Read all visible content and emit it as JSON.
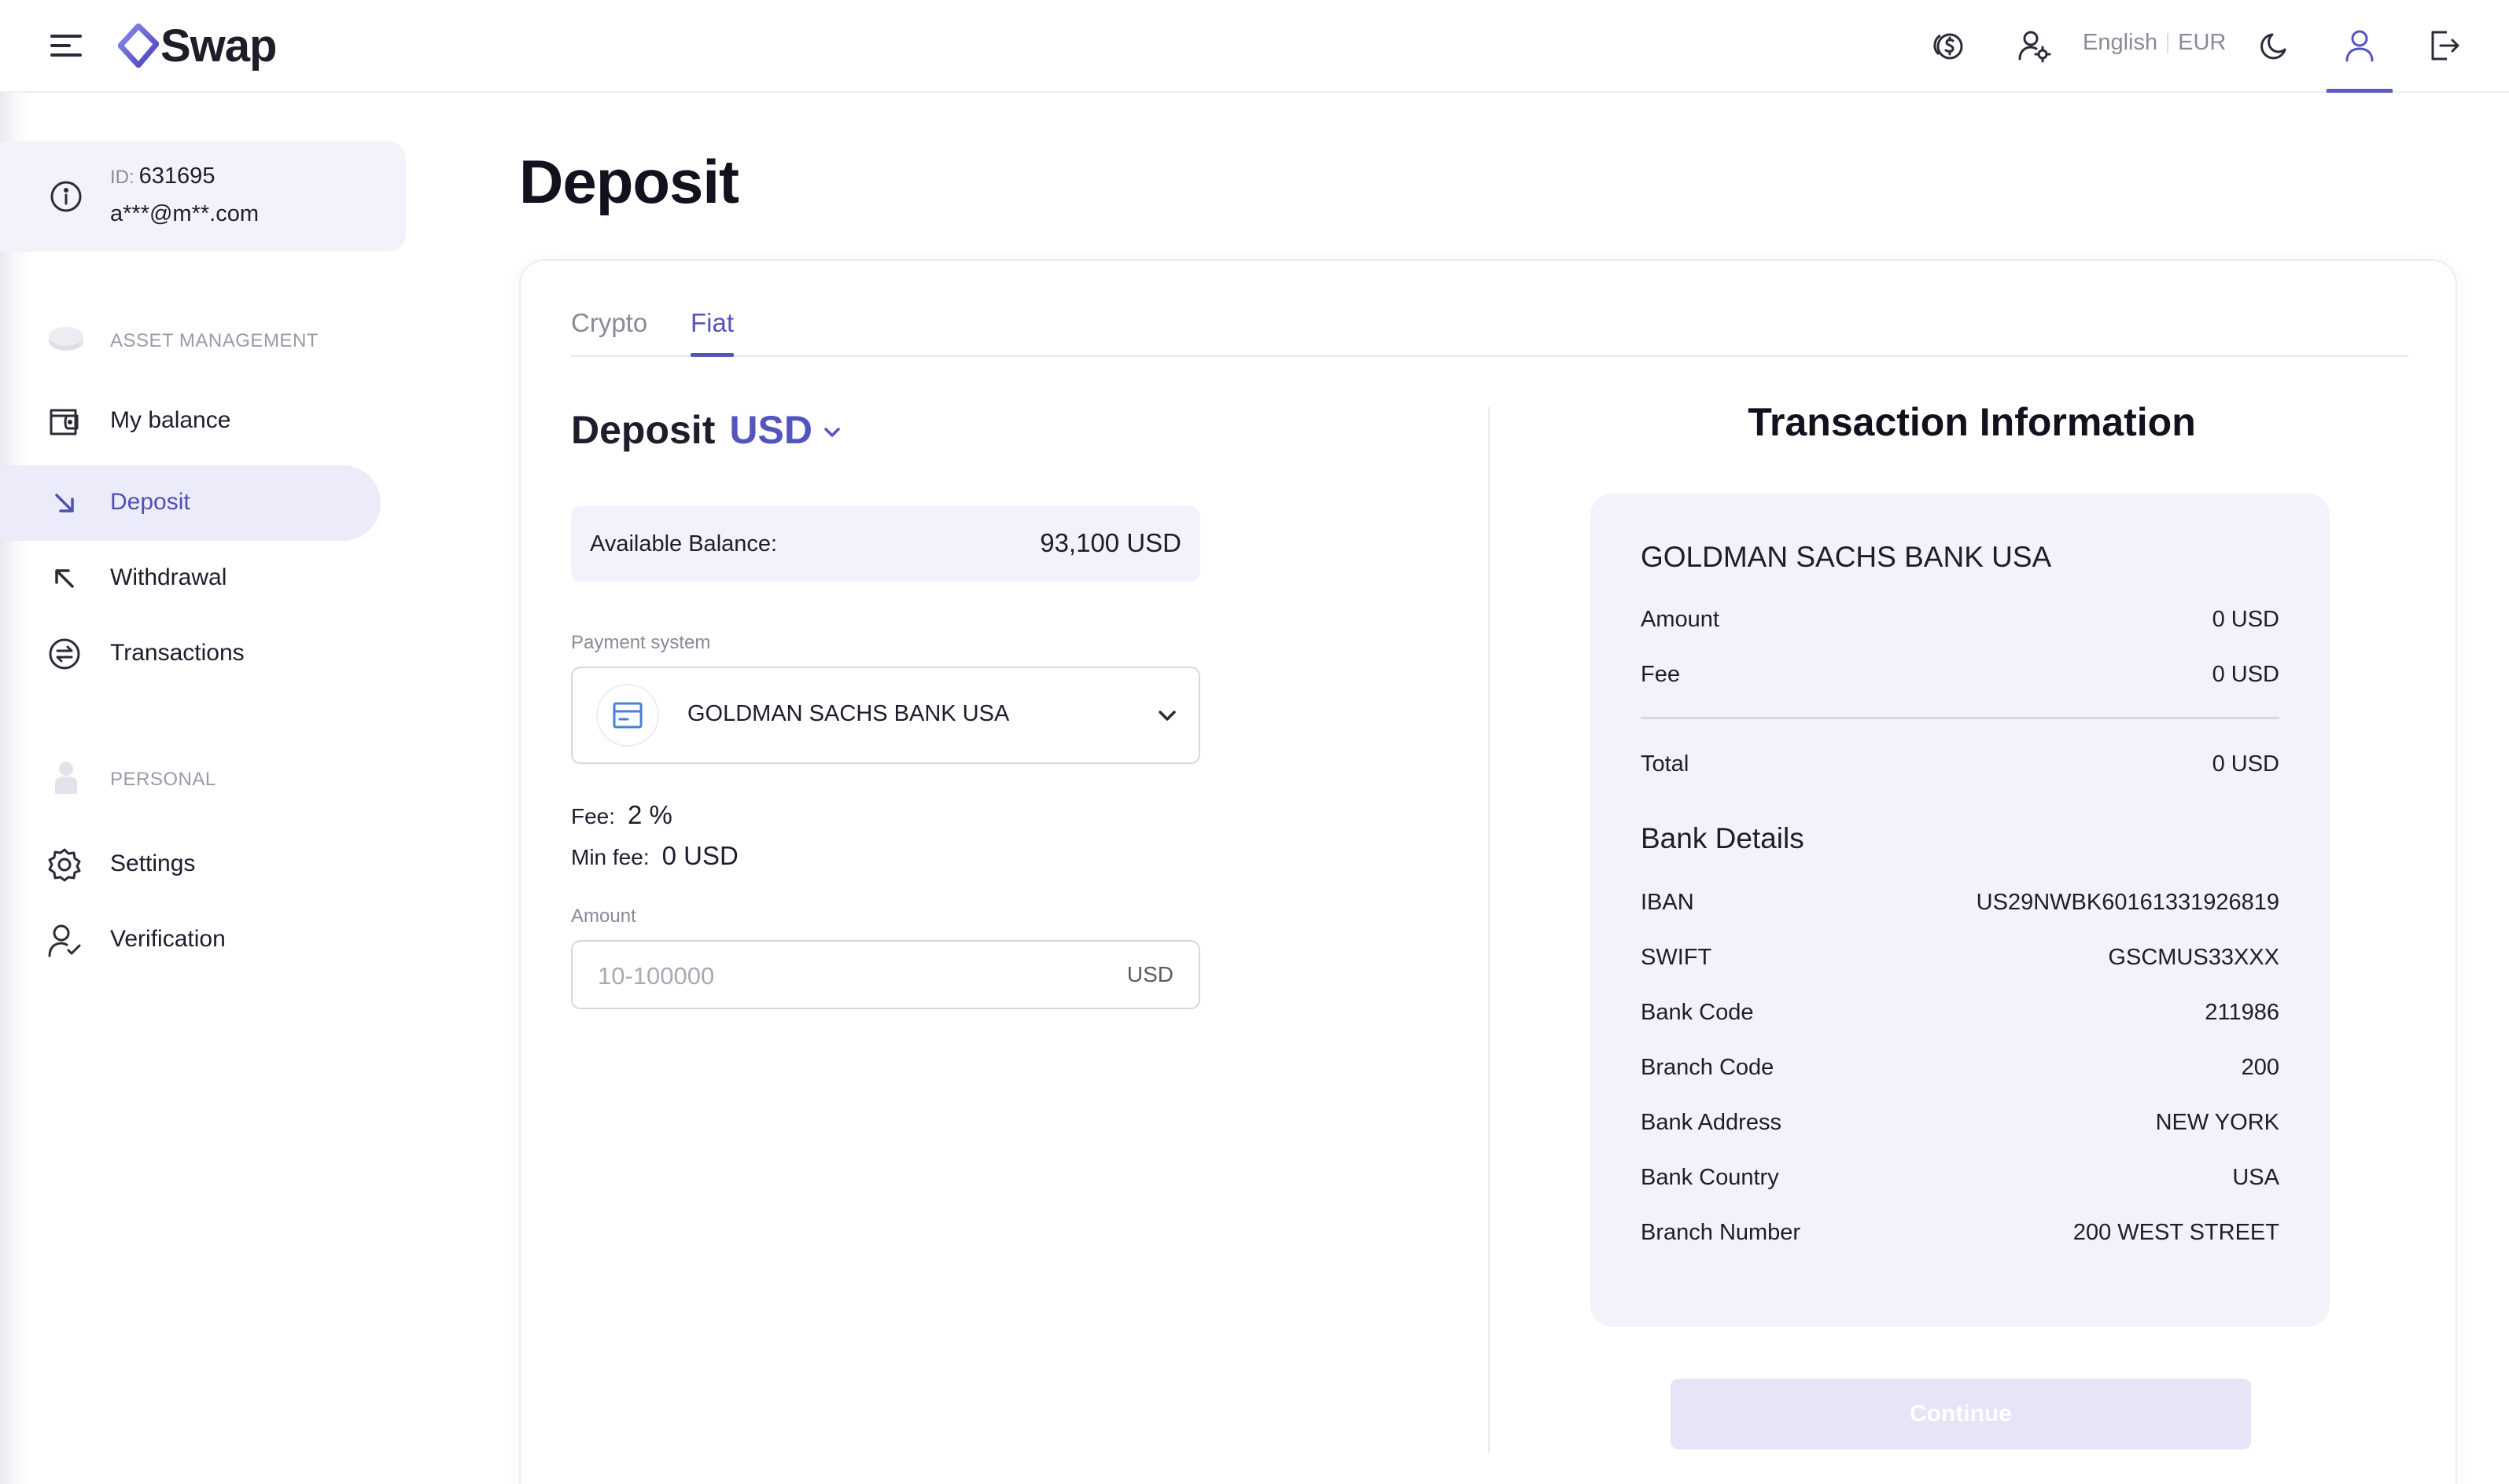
{
  "header": {
    "logo_text": "Swap",
    "language": "English",
    "currency": "EUR",
    "icons": [
      "menu-icon",
      "coins-icon",
      "user-settings-icon",
      "moon-icon",
      "profile-icon",
      "logout-icon"
    ],
    "accent_color": "#5454bf"
  },
  "sidebar": {
    "user": {
      "id_label": "ID:",
      "id_value": "631695",
      "email": "a***@m**.com"
    },
    "sections": [
      {
        "label": "ASSET MANAGEMENT"
      },
      {
        "label": "PERSONAL"
      }
    ],
    "items": [
      {
        "label": "My balance",
        "icon": "wallet-icon"
      },
      {
        "label": "Deposit",
        "icon": "arrow-down-right-icon",
        "active": true
      },
      {
        "label": "Withdrawal",
        "icon": "arrow-up-left-icon"
      },
      {
        "label": "Transactions",
        "icon": "exchange-icon"
      },
      {
        "label": "Settings",
        "icon": "gear-icon"
      },
      {
        "label": "Verification",
        "icon": "user-check-icon"
      }
    ]
  },
  "main": {
    "title": "Deposit",
    "tabs": [
      {
        "label": "Crypto"
      },
      {
        "label": "Fiat",
        "active": true
      }
    ],
    "deposit": {
      "label": "Deposit",
      "currency": "USD",
      "available_balance_label": "Available Balance:",
      "available_balance_value": "93,100 USD",
      "payment_system_label": "Payment system",
      "payment_system_value": "GOLDMAN SACHS BANK USA",
      "fee_label": "Fee:",
      "fee_value": "2 %",
      "min_fee_label": "Min fee:",
      "min_fee_value": "0 USD",
      "amount_label": "Amount",
      "amount_placeholder": "10-100000",
      "amount_unit": "USD"
    },
    "transaction_info": {
      "title": "Transaction Information",
      "bank_name": "GOLDMAN SACHS BANK USA",
      "amount_label": "Amount",
      "amount_value": "0 USD",
      "fee_label": "Fee",
      "fee_value": "0 USD",
      "total_label": "Total",
      "total_value": "0 USD",
      "bank_details_title": "Bank Details",
      "bank_details": [
        {
          "key": "IBAN",
          "value": "US29NWBK60161331926819"
        },
        {
          "key": "SWIFT",
          "value": "GSCMUS33XXX"
        },
        {
          "key": "Bank Code",
          "value": "211986"
        },
        {
          "key": "Branch Code",
          "value": "200"
        },
        {
          "key": "Bank Address",
          "value": "NEW YORK"
        },
        {
          "key": "Bank Country",
          "value": "USA"
        },
        {
          "key": "Branch Number",
          "value": "200 WEST STREET"
        }
      ],
      "continue_label": "Continue"
    }
  }
}
